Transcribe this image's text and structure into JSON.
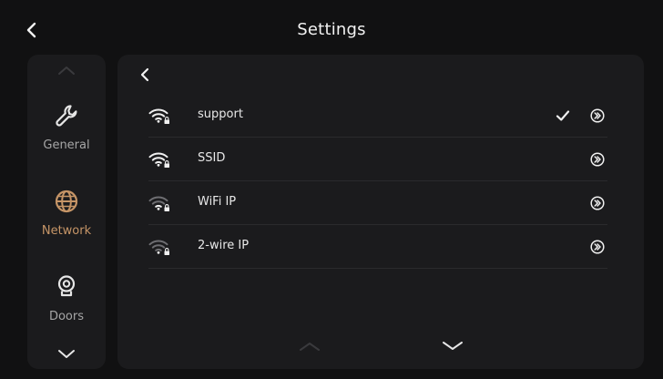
{
  "header": {
    "title": "Settings",
    "back_icon": "chevron-left-icon"
  },
  "sidebar": {
    "scroll_up_icon": "chevron-up-icon",
    "scroll_down_icon": "chevron-down-icon",
    "items": [
      {
        "label": "General",
        "icon": "wrench-icon",
        "active": false
      },
      {
        "label": "Network",
        "icon": "globe-icon",
        "active": true
      },
      {
        "label": "Doors",
        "icon": "doorbell-camera-icon",
        "active": false
      }
    ]
  },
  "panel": {
    "back_icon": "chevron-left-icon",
    "networks": [
      {
        "label": "support",
        "icon": "wifi-lock-icon",
        "strength": "full",
        "connected": true
      },
      {
        "label": "SSID",
        "icon": "wifi-lock-icon",
        "strength": "full",
        "connected": false
      },
      {
        "label": "WiFi IP",
        "icon": "wifi-lock-icon",
        "strength": "weak",
        "connected": false
      },
      {
        "label": "2-wire IP",
        "icon": "wifi-lock-icon",
        "strength": "weak",
        "connected": false
      }
    ],
    "pager": {
      "up_icon": "chevron-up-icon",
      "down_icon": "chevron-down-icon"
    }
  },
  "colors": {
    "background": "#111112",
    "panel": "#1b1b1d",
    "accent": "#c69567",
    "text": "#e8e8e8",
    "muted": "#a6a6a6",
    "disabled": "#3a3a3d"
  }
}
